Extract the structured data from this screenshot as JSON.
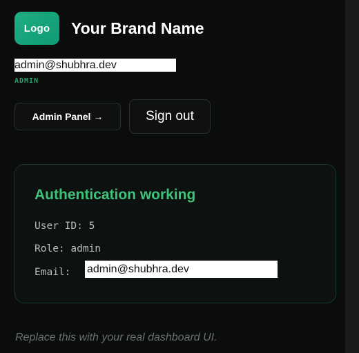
{
  "header": {
    "logo_label": "Logo",
    "brand_name": "Your Brand Name"
  },
  "user": {
    "email": "admin@shubhra.dev",
    "role_tag": "ADMIN"
  },
  "actions": {
    "admin_panel_label": "Admin Panel →",
    "sign_out_label": "Sign out"
  },
  "status_card": {
    "title": "Authentication working",
    "user_id_line": "User ID: 5",
    "role_line": "Role: admin",
    "email_label": "Email:",
    "email_value": "admin@shubhra.dev"
  },
  "footer": {
    "note": "Replace this with your real dashboard UI."
  },
  "colors": {
    "background": "#0b0c0c",
    "accent_green": "#3ec27a",
    "logo_gradient_start": "#1fae83",
    "logo_gradient_end": "#0f9a74"
  }
}
